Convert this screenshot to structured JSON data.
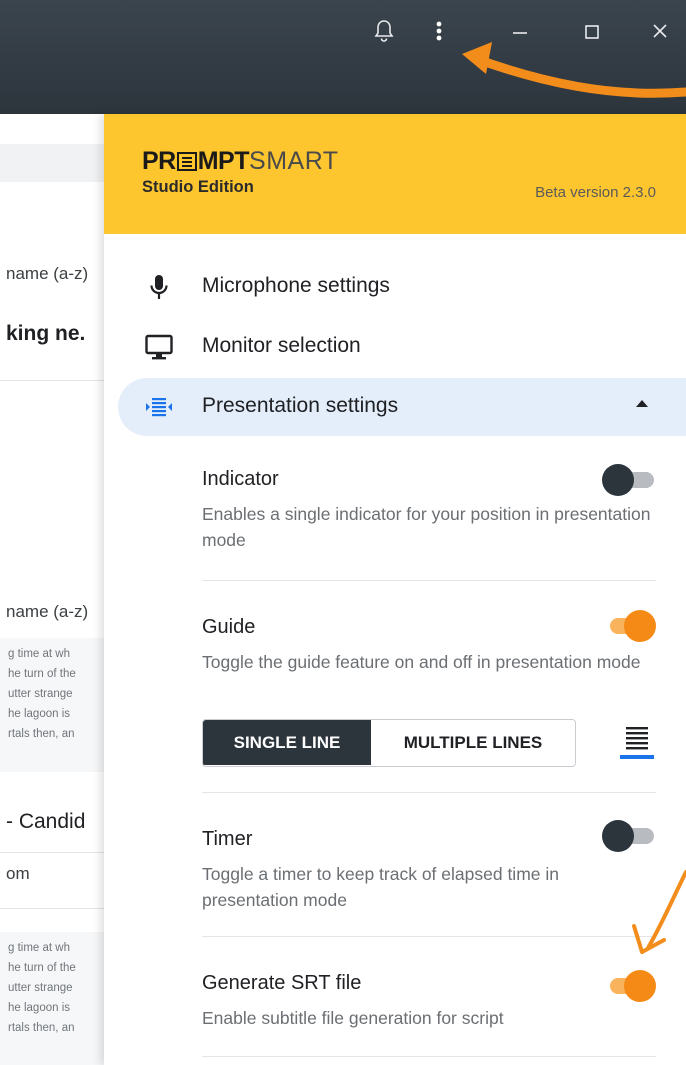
{
  "background_app": {
    "sort_label_1": "name (a-z)",
    "heading_1": "king ne.",
    "sort_label_2": "name (a-z)",
    "snippet_1": [
      "g time at wh",
      "he turn of the",
      "utter strange",
      "he lagoon is",
      "rtals then, an"
    ],
    "heading_2": "- Candid",
    "email_fragment": "om",
    "snippet_2": [
      "g time at wh",
      "he turn of the",
      "utter strange",
      "he lagoon is",
      "rtals then, an"
    ]
  },
  "window_controls": {
    "icons": [
      "bell-icon",
      "more-vert-icon",
      "minimize-icon",
      "maximize-icon",
      "close-icon"
    ]
  },
  "brand": {
    "logo_strong_1": "PR",
    "logo_strong_2": "MPT",
    "logo_light": "SMART",
    "edition": "Studio Edition",
    "version": "Beta version 2.3.0"
  },
  "menu": {
    "microphone": "Microphone settings",
    "monitor": "Monitor selection",
    "presentation": "Presentation settings"
  },
  "settings": {
    "indicator": {
      "title": "Indicator",
      "desc": "Enables a single indicator for your position in presentation mode",
      "enabled": false
    },
    "guide": {
      "title": "Guide",
      "desc": "Toggle the guide feature on and off in presentation mode",
      "enabled": true,
      "modes": [
        "SINGLE LINE",
        "MULTIPLE LINES"
      ],
      "selected_mode": "SINGLE LINE"
    },
    "timer": {
      "title": "Timer",
      "desc": "Toggle a timer to keep track of elapsed time in presentation mode",
      "enabled": false
    },
    "srt": {
      "title": "Generate SRT file",
      "desc": "Enable subtitle file generation for script",
      "enabled": true
    }
  },
  "colors": {
    "accent_orange": "#f58a16",
    "brand_yellow": "#fdc62f",
    "titlebar": "#2c343c",
    "active_bg": "#e4eefa",
    "link_blue": "#1a73e8"
  }
}
